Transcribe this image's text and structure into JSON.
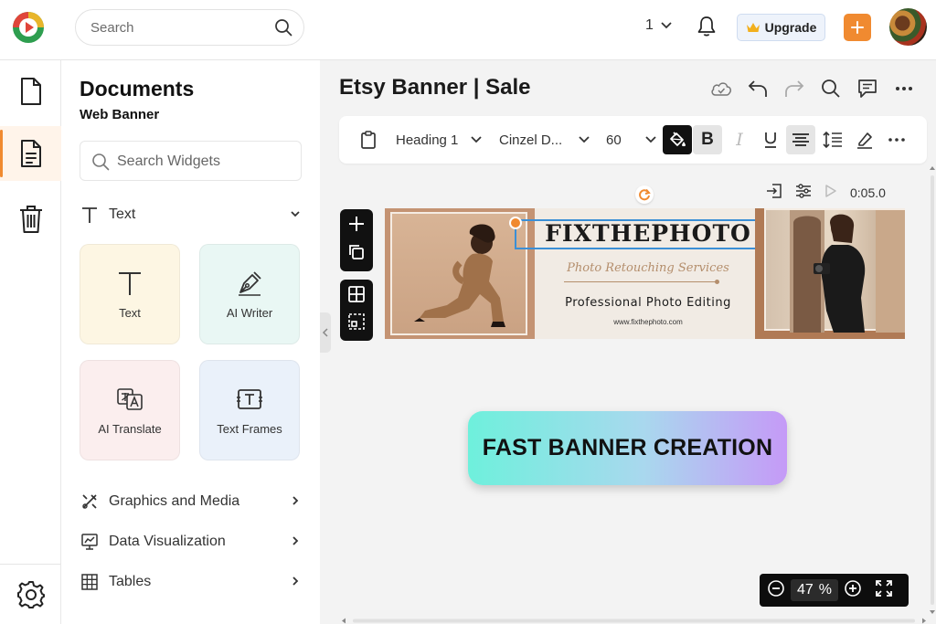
{
  "topbar": {
    "search_placeholder": "Search",
    "page_number": "1",
    "upgrade_label": "Upgrade",
    "colors": {
      "accent": "#f08a30"
    }
  },
  "rail": {
    "items": [
      "document-icon",
      "page-icon",
      "trash-icon",
      "gear-icon"
    ]
  },
  "panel": {
    "title": "Documents",
    "subtitle": "Web Banner",
    "search_placeholder": "Search Widgets",
    "text_section": "Text",
    "cards": [
      {
        "label": "Text",
        "color": "#fdf6e3"
      },
      {
        "label": "AI Writer",
        "color": "#e9f7f4"
      },
      {
        "label": "AI Translate",
        "color": "#fbeeee"
      },
      {
        "label": "Text Frames",
        "color": "#eaf1fa"
      }
    ],
    "sections": [
      "Graphics and Media",
      "Data Visualization",
      "Tables"
    ]
  },
  "editor": {
    "doc_title": "Etsy Banner | Sale",
    "toolbar": {
      "style": "Heading 1",
      "font": "Cinzel D...",
      "size": "60"
    },
    "duration": "0:05.0"
  },
  "banner": {
    "brand": "FIXTHEPHOTO",
    "tagline": "Photo Retouching Services",
    "headline": "Professional Photo Editing",
    "url": "www.fixthephoto.com"
  },
  "promo": {
    "label": "FAST BANNER CREATION"
  },
  "zoom": {
    "value": "47",
    "unit": "%"
  }
}
